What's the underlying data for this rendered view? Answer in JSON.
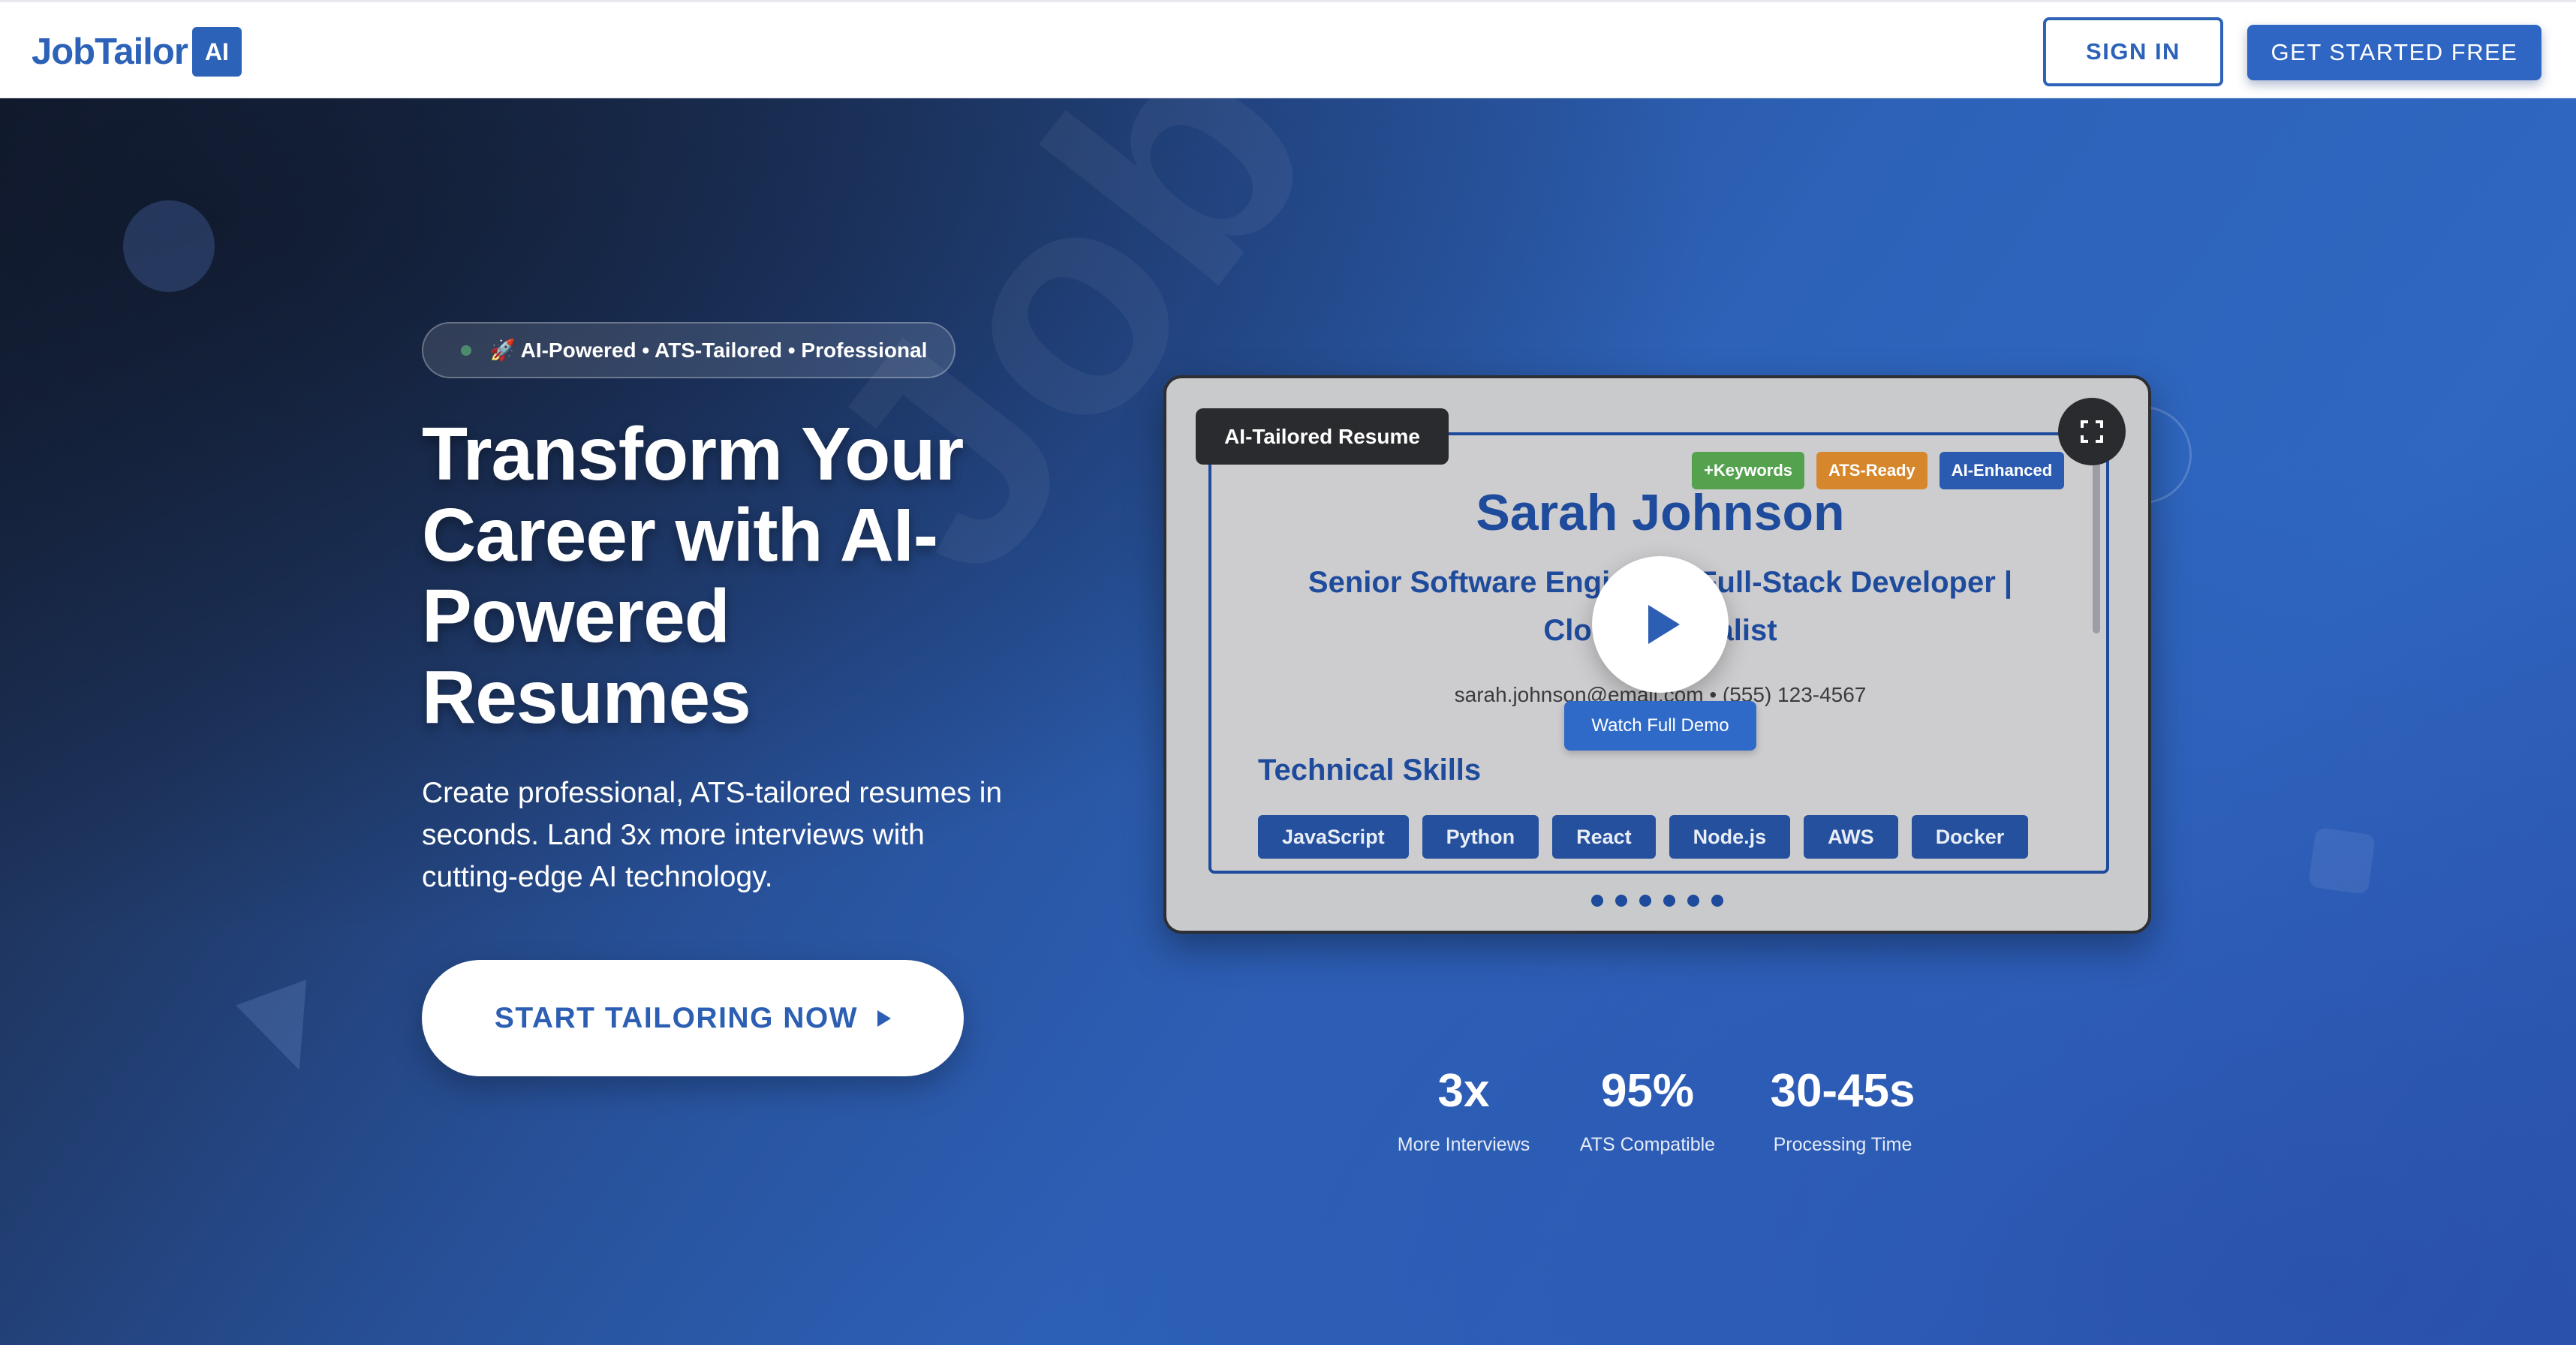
{
  "nav": {
    "logo_text": "JobTailor",
    "logo_badge": "AI",
    "signin_label": "SIGN IN",
    "get_started_label": "GET STARTED FREE"
  },
  "hero": {
    "pill_text": "🚀 AI-Powered • ATS-Tailored • Professional",
    "headline_lines": [
      "Transform Your",
      "Career with AI-",
      "Powered",
      "Resumes"
    ],
    "subtext": "Create professional, ATS-tailored resumes in seconds. Land 3x more interviews with cutting-edge AI technology.",
    "cta_label": "START TAILORING NOW",
    "watermark_text": "JobTailor AI"
  },
  "video": {
    "label": "AI-Tailored Resume",
    "tags": [
      "+Keywords",
      "ATS-Ready",
      "AI-Enhanced"
    ],
    "resume_name": "Sarah Johnson",
    "resume_title": "Senior Software Engineer | Full-Stack Developer | Cloud Specialist",
    "resume_contact": "sarah.johnson@email.com • (555) 123-4567",
    "skills_heading": "Technical Skills",
    "skills": [
      "JavaScript",
      "Python",
      "React",
      "Node.js",
      "AWS",
      "Docker"
    ],
    "watch_demo_label": "Watch Full Demo",
    "slide_count": 6
  },
  "stats": [
    {
      "value": "3x",
      "label": "More Interviews"
    },
    {
      "value": "95%",
      "label": "ATS Compatible"
    },
    {
      "value": "30-45s",
      "label": "Processing Time"
    }
  ],
  "colors": {
    "brand_blue": "#2c62b8",
    "tag_green": "#54a14e",
    "tag_orange": "#d6862b",
    "tag_blue": "#2a5bb0"
  },
  "icons": {
    "fullscreen": "fullscreen-icon",
    "play": "play-icon",
    "arrow": "arrow-right-icon"
  }
}
